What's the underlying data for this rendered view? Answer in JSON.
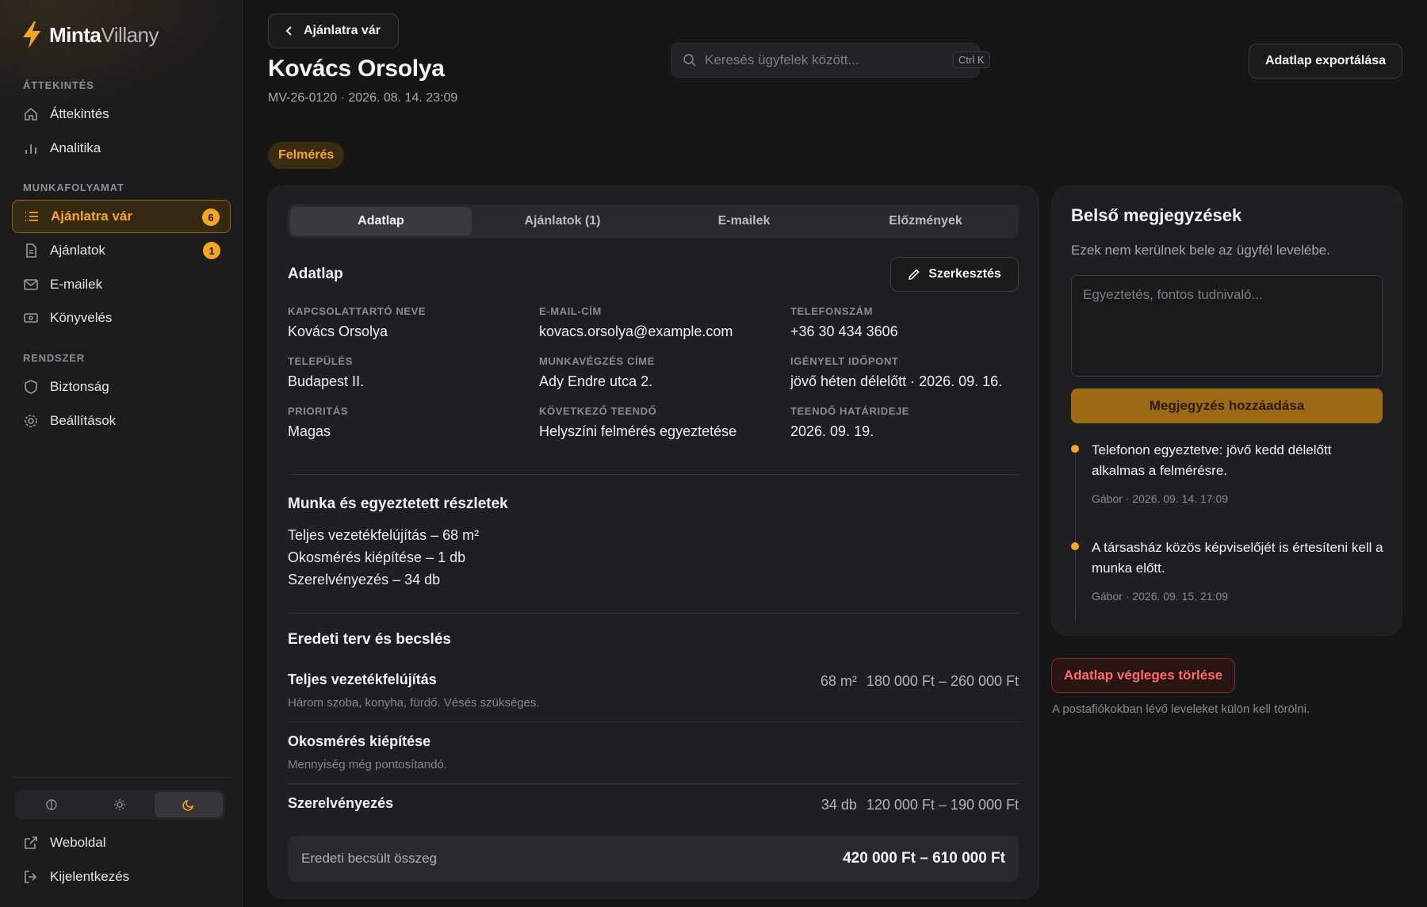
{
  "brand": {
    "name_primary": "Minta",
    "name_secondary": "Villany",
    "accent": "#f5a623"
  },
  "sidebar": {
    "sections": [
      {
        "title": "ÁTTEKINTÉS"
      },
      {
        "title": "MUNKAFOLYAMAT"
      },
      {
        "title": "RENDSZER"
      }
    ],
    "items": [
      {
        "label": "Áttekintés",
        "icon": "home-icon"
      },
      {
        "label": "Analitika",
        "icon": "bar-chart-icon"
      },
      {
        "label": "Ajánlatra vár",
        "icon": "list-icon",
        "badge": "6",
        "active": true
      },
      {
        "label": "Ajánlatok",
        "icon": "document-icon",
        "badge": "1"
      },
      {
        "label": "E-mailek",
        "icon": "mail-icon"
      },
      {
        "label": "Könyvelés",
        "icon": "banknote-icon"
      },
      {
        "label": "Biztonság",
        "icon": "shield-icon"
      },
      {
        "label": "Beállítások",
        "icon": "gear-icon"
      }
    ],
    "footer": [
      {
        "label": "Weboldal",
        "icon": "external-link-icon"
      },
      {
        "label": "Kijelentkezés",
        "icon": "logout-icon"
      }
    ],
    "theme_options": [
      "system",
      "light",
      "dark"
    ],
    "theme_selected": "dark"
  },
  "header": {
    "back_label": "Ajánlatra vár",
    "title": "Kovács Orsolya",
    "subtitle": "MV-26-0120 · 2026. 08. 14. 23:09",
    "search_placeholder": "Keresés ügyfelek között...",
    "search_shortcut": "Ctrl K",
    "export_label": "Adatlap exportálása",
    "status": "Felmérés"
  },
  "tabs": [
    {
      "label": "Adatlap",
      "active": true
    },
    {
      "label": "Ajánlatok (1)"
    },
    {
      "label": "E-mailek"
    },
    {
      "label": "Előzmények"
    }
  ],
  "datasheet": {
    "title": "Adatlap",
    "edit_label": "Szerkesztés",
    "fields": [
      {
        "label": "KAPCSOLATTARTÓ NEVE",
        "value": "Kovács Orsolya"
      },
      {
        "label": "E-MAIL-CÍM",
        "value": "kovacs.orsolya@example.com"
      },
      {
        "label": "TELEFONSZÁM",
        "value": "+36 30 434 3606"
      },
      {
        "label": "TELEPÜLÉS",
        "value": "Budapest II."
      },
      {
        "label": "MUNKAVÉGZÉS CÍME",
        "value": "Ady Endre utca 2."
      },
      {
        "label": "IGÉNYELT IDŐPONT",
        "value": "jövő héten délelőtt · 2026. 09. 16."
      },
      {
        "label": "PRIORITÁS",
        "value": "Magas"
      },
      {
        "label": "KÖVETKEZŐ TEENDŐ",
        "value": "Helyszíni felmérés egyeztetése"
      },
      {
        "label": "TEENDŐ HATÁRIDEJE",
        "value": "2026. 09. 19."
      }
    ]
  },
  "work": {
    "title": "Munka és egyeztetett részletek",
    "lines": [
      "Teljes vezetékfelújítás – 68 m²",
      "Okosmérés kiépítése – 1 db",
      "Szerelvényezés – 34 db"
    ]
  },
  "estimate": {
    "title": "Eredeti terv és becslés",
    "items": [
      {
        "name": "Teljes vezetékfelújítás",
        "desc": "Három szoba, konyha, fürdő. Vésés szükséges.",
        "qty": "68 m²",
        "range": "180 000 Ft – 260 000 Ft"
      },
      {
        "name": "Okosmérés kiépítése",
        "desc": "Mennyiség még pontosítandó.",
        "qty": "",
        "range": ""
      },
      {
        "name": "Szerelvényezés",
        "desc": "",
        "qty": "34 db",
        "range": "120 000 Ft – 190 000 Ft"
      }
    ],
    "total_label": "Eredeti becsült összeg",
    "total_value": "420 000 Ft – 610 000 Ft"
  },
  "notes": {
    "title": "Belső megjegyzések",
    "subtitle": "Ezek nem kerülnek bele az ügyfél levelébe.",
    "placeholder": "Egyeztetés, fontos tudnivaló...",
    "add_label": "Megjegyzés hozzáadása",
    "items": [
      {
        "text": "Telefonon egyeztetve: jövő kedd délelőtt alkalmas a felmérésre.",
        "meta": "Gábor · 2026. 09. 14. 17:09"
      },
      {
        "text": "A társasház közös képviselőjét is értesíteni kell a munka előtt.",
        "meta": "Gábor · 2026. 09. 15. 21:09"
      }
    ]
  },
  "danger": {
    "delete_label": "Adatlap végleges törlése",
    "hint": "A postafiókokban lévő leveleket külön kell törölni."
  }
}
